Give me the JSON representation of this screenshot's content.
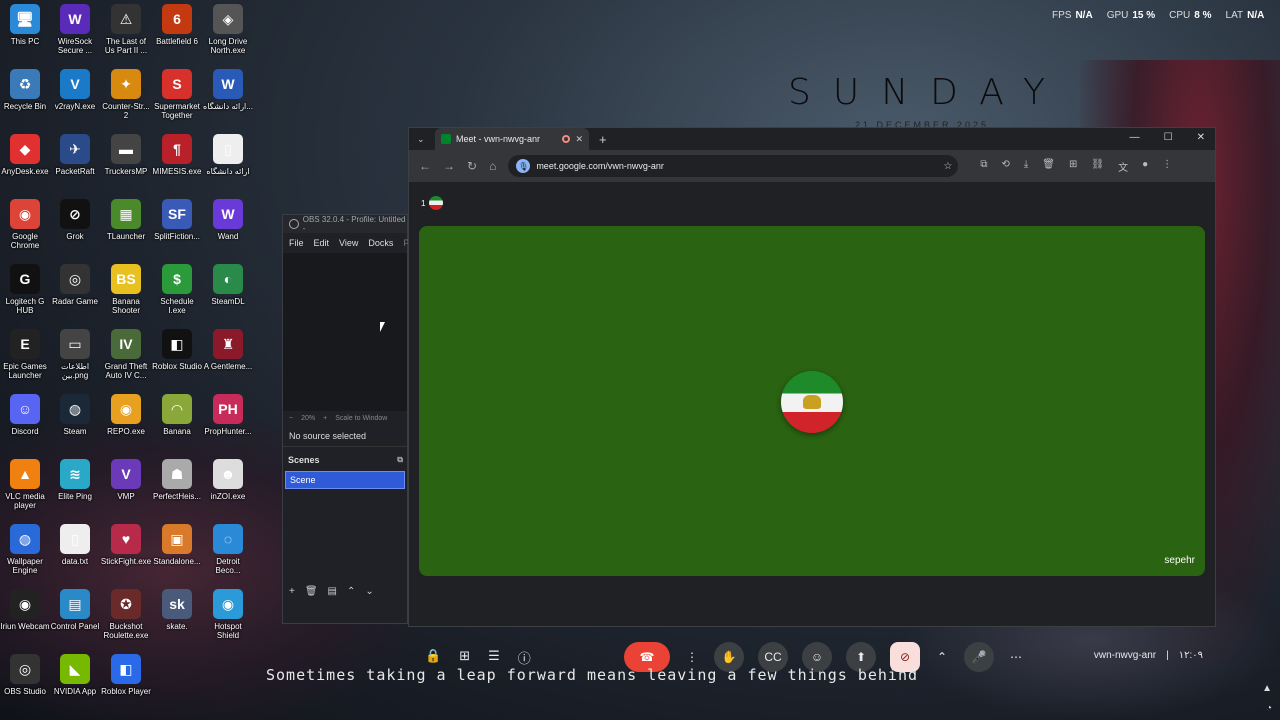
{
  "wallpaper": {
    "title": "SUNDAY",
    "date": "21 DECEMBER 2025",
    "subtitle": "Sometimes taking a leap forward means leaving a few things behind"
  },
  "hud": {
    "fps_label": "FPS",
    "fps_value": "N/A",
    "gpu_label": "GPU",
    "gpu_value": "15 %",
    "cpu_label": "CPU",
    "cpu_value": "8 %",
    "lat_label": "LAT",
    "lat_value": "N/A"
  },
  "desktop_icons": [
    {
      "label": "This PC",
      "glyph": "🖥",
      "color": "#2a8ad8"
    },
    {
      "label": "WireSock Secure ...",
      "glyph": "W",
      "color": "#5a2ab8"
    },
    {
      "label": "The Last of Us Part II ...",
      "glyph": "⚠",
      "color": "#333"
    },
    {
      "label": "Battlefield 6",
      "glyph": "6",
      "color": "#c43a10"
    },
    {
      "label": "Long Drive North.exe",
      "glyph": "◈",
      "color": "#555"
    },
    {
      "label": "Recycle Bin",
      "glyph": "♻",
      "color": "#3a7ab8"
    },
    {
      "label": "v2rayN.exe",
      "glyph": "V",
      "color": "#1a7ac8"
    },
    {
      "label": "Counter-Str... 2",
      "glyph": "✦",
      "color": "#d88a10"
    },
    {
      "label": "Supermarket Together",
      "glyph": "S",
      "color": "#d8302a"
    },
    {
      "label": "ارائه دانشگاه...",
      "glyph": "W",
      "color": "#2a5ab8"
    },
    {
      "label": "AnyDesk.exe",
      "glyph": "◆",
      "color": "#e03030"
    },
    {
      "label": "PacketRaft",
      "glyph": "✈",
      "color": "#2a4a8a"
    },
    {
      "label": "TruckersMP",
      "glyph": "▬",
      "color": "#444"
    },
    {
      "label": "MIMESIS.exe",
      "glyph": "¶",
      "color": "#b8202a"
    },
    {
      "label": "ارائه دانشگاه",
      "glyph": "▯",
      "color": "#eee"
    },
    {
      "label": "Google Chrome",
      "glyph": "◉",
      "color": "#db4437"
    },
    {
      "label": "Grok",
      "glyph": "⊘",
      "color": "#111"
    },
    {
      "label": "TLauncher",
      "glyph": "▦",
      "color": "#4a8a2a"
    },
    {
      "label": "SplitFiction...",
      "glyph": "SF",
      "color": "#3a5ab8"
    },
    {
      "label": "Wand",
      "glyph": "W",
      "color": "#6a3ad8"
    },
    {
      "label": "Logitech G HUB",
      "glyph": "G",
      "color": "#111"
    },
    {
      "label": "Radar Game",
      "glyph": "◎",
      "color": "#333"
    },
    {
      "label": "Banana Shooter",
      "glyph": "BS",
      "color": "#e8c020"
    },
    {
      "label": "Schedule I.exe",
      "glyph": "$",
      "color": "#2a9a3a"
    },
    {
      "label": "SteamDL",
      "glyph": "◐",
      "color": "#2a8a4a"
    },
    {
      "label": "Epic Games Launcher",
      "glyph": "E",
      "color": "#222"
    },
    {
      "label": "اطلاعات بین.png",
      "glyph": "▭",
      "color": "#444"
    },
    {
      "label": "Grand Theft Auto IV C...",
      "glyph": "IV",
      "color": "#4a6a3a"
    },
    {
      "label": "Roblox Studio",
      "glyph": "◧",
      "color": "#111"
    },
    {
      "label": "A Gentleme...",
      "glyph": "♜",
      "color": "#8a1a2a"
    },
    {
      "label": "Discord",
      "glyph": "☺",
      "color": "#5865f2"
    },
    {
      "label": "Steam",
      "glyph": "◍",
      "color": "#1b2838"
    },
    {
      "label": "REPO.exe",
      "glyph": "◉",
      "color": "#e8a020"
    },
    {
      "label": "Banana",
      "glyph": "◠",
      "color": "#8aa83a"
    },
    {
      "label": "PropHunter...",
      "glyph": "PH",
      "color": "#c82a5a"
    },
    {
      "label": "VLC media player",
      "glyph": "▲",
      "color": "#f08010"
    },
    {
      "label": "Elite Ping",
      "glyph": "≋",
      "color": "#2aa8c8"
    },
    {
      "label": "VMP",
      "glyph": "V",
      "color": "#6a3ab8"
    },
    {
      "label": "PerfectHeis...",
      "glyph": "☗",
      "color": "#aaa"
    },
    {
      "label": "inZOI.exe",
      "glyph": "☻",
      "color": "#ddd"
    },
    {
      "label": "Wallpaper Engine",
      "glyph": "◍",
      "color": "#2a6ad8"
    },
    {
      "label": "data.txt",
      "glyph": "▯",
      "color": "#eee"
    },
    {
      "label": "StickFight.exe",
      "glyph": "♥",
      "color": "#b82a4a"
    },
    {
      "label": "Standalone...",
      "glyph": "▣",
      "color": "#d87a2a"
    },
    {
      "label": "Detroit Beco...",
      "glyph": "◌",
      "color": "#2a8ad8"
    },
    {
      "label": "Iriun Webcam",
      "glyph": "◉",
      "color": "#222"
    },
    {
      "label": "Control Panel",
      "glyph": "▤",
      "color": "#2a8ac8"
    },
    {
      "label": "Buckshot Roulette.exe",
      "glyph": "✪",
      "color": "#6a2a2a"
    },
    {
      "label": "skate.",
      "glyph": "sk",
      "color": "#4a5a7a"
    },
    {
      "label": "Hotspot Shield",
      "glyph": "◉",
      "color": "#2a9ad8"
    },
    {
      "label": "OBS Studio",
      "glyph": "◎",
      "color": "#333"
    },
    {
      "label": "NVIDIA App",
      "glyph": "◣",
      "color": "#76b900"
    },
    {
      "label": "Roblox Player",
      "glyph": "◧",
      "color": "#2a6ae8"
    }
  ],
  "obs": {
    "title": "OBS 32.0.4 - Profile: Untitled -",
    "menu": [
      "File",
      "Edit",
      "View",
      "Docks",
      "Pr"
    ],
    "zoom_minus": "−",
    "zoom": "20%",
    "zoom_plus": "+",
    "scale": "Scale to Window",
    "no_source": "No source selected",
    "scenes_header": "Scenes",
    "scene_item": "Scene"
  },
  "chrome": {
    "tab_title": "Meet - vwn-nwvg-anr",
    "url": "meet.google.com/vwn-nwvg-anr"
  },
  "meet": {
    "participants": "1",
    "participant_name": "sepehr",
    "meeting_code": "vwn-nwvg-anr",
    "time": "۱۲:۰۹",
    "separator": "|"
  },
  "tray": {
    "a": "▲",
    "b": "◔"
  }
}
